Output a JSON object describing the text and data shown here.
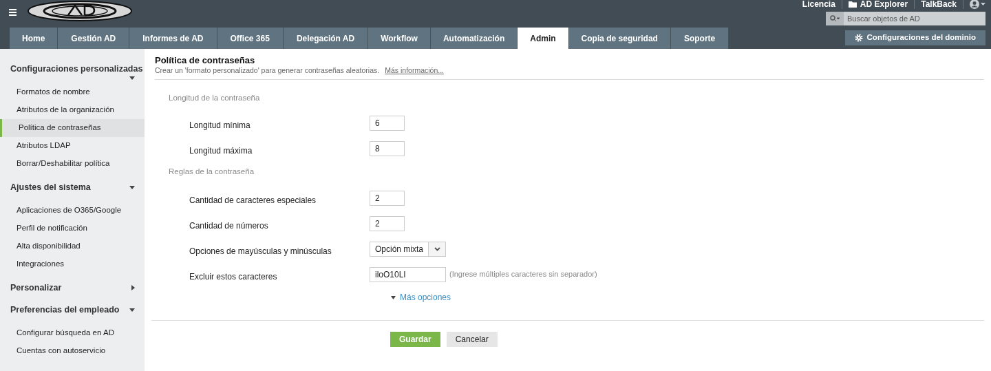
{
  "header": {
    "links": [
      {
        "label": "Licencia",
        "kind": "text"
      },
      {
        "label": "AD Explorer",
        "kind": "folder"
      },
      {
        "label": "TalkBack",
        "kind": "text"
      }
    ],
    "search": {
      "placeholder": "Buscar objetos de AD"
    }
  },
  "tabs": [
    {
      "label": "Home",
      "selected": false
    },
    {
      "label": "Gestión AD",
      "selected": false
    },
    {
      "label": "Informes de AD",
      "selected": false
    },
    {
      "label": "Office 365",
      "selected": false
    },
    {
      "label": "Delegación AD",
      "selected": false
    },
    {
      "label": "Workflow",
      "selected": false
    },
    {
      "label": "Automatización",
      "selected": false
    },
    {
      "label": "Admin",
      "selected": true
    },
    {
      "label": "Copia de seguridad",
      "selected": false
    },
    {
      "label": "Soporte",
      "selected": false
    }
  ],
  "domain_button": "Configuraciones del dominio",
  "sidebar": {
    "groups": [
      {
        "label": "Configuraciones personalizadas",
        "expanded": true,
        "children": [
          {
            "label": "Formatos de nombre",
            "selected": false
          },
          {
            "label": "Atributos de la organización",
            "selected": false
          },
          {
            "label": "Política de contraseñas",
            "selected": true
          },
          {
            "label": "Atributos LDAP",
            "selected": false
          },
          {
            "label": "Borrar/Deshabilitar política",
            "selected": false
          }
        ]
      },
      {
        "label": "Ajustes del sistema",
        "expanded": true,
        "children": [
          {
            "label": "Aplicaciones de O365/Google",
            "selected": false
          },
          {
            "label": "Perfil de notificación",
            "selected": false
          },
          {
            "label": "Alta disponibilidad",
            "selected": false
          },
          {
            "label": "Integraciones",
            "selected": false
          }
        ]
      },
      {
        "label": "Personalizar",
        "expanded": false
      },
      {
        "label": "Preferencias del empleado",
        "expanded": true,
        "children": [
          {
            "label": "Configurar búsqueda en AD",
            "selected": false
          },
          {
            "label": "Cuentas con autoservicio",
            "selected": false
          }
        ]
      }
    ]
  },
  "page": {
    "title": "Política de contraseñas",
    "subtitle": "Crear un 'formato personalizado' para generar contraseñas aleatorias.",
    "link": "Más información...",
    "sections": [
      {
        "heading": "Longitud de la contraseña",
        "fields": [
          {
            "label": "Longitud mínima",
            "kind": "number",
            "value": "6"
          },
          {
            "label": "Longitud máxima",
            "kind": "number",
            "value": "8"
          }
        ]
      },
      {
        "heading": "Reglas de la contraseña",
        "fields": [
          {
            "label": "Cantidad de caracteres especiales",
            "kind": "number",
            "value": "2"
          },
          {
            "label": "Cantidad de números",
            "kind": "number",
            "value": "2"
          },
          {
            "label": "Opciones de mayúsculas y minúsculas",
            "kind": "select",
            "value": "Opción mixta"
          },
          {
            "label": "Excluir estos caracteres",
            "kind": "text",
            "value": "iloO10LI",
            "hint": "(Ingrese múltiples caracteres sin separador)"
          }
        ]
      }
    ],
    "more": "Más opciones",
    "buttons": [
      {
        "label": "Guardar",
        "kind": "primary"
      },
      {
        "label": "Cancelar",
        "kind": "secondary"
      }
    ]
  }
}
